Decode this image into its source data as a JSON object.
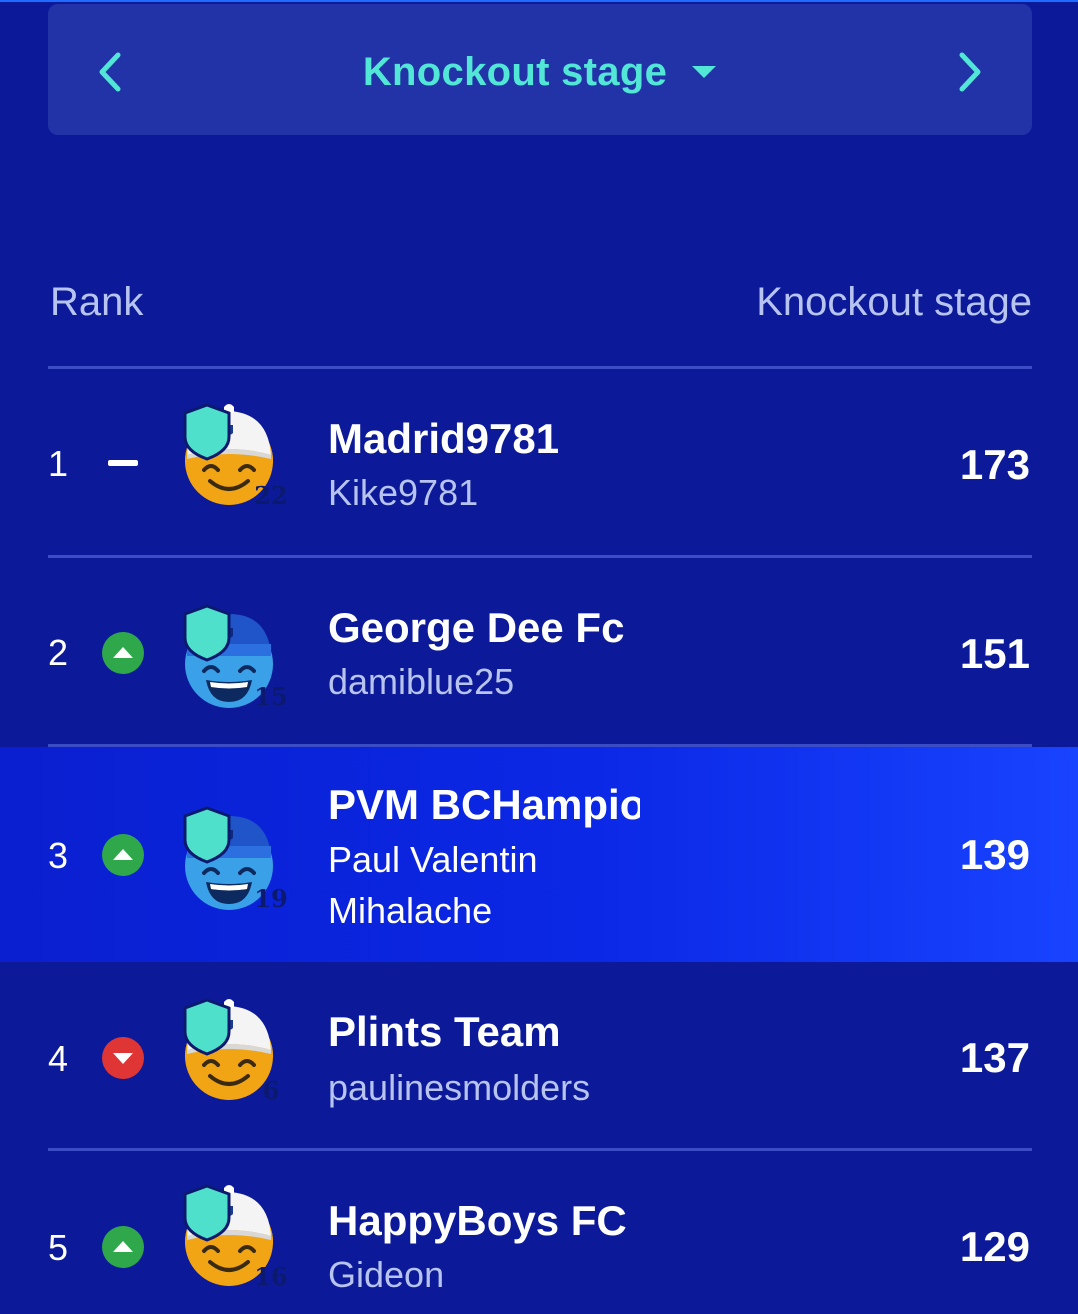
{
  "stage_selector": {
    "title": "Knockout stage",
    "prev_icon": "chevron-left-icon",
    "next_icon": "chevron-right-icon",
    "dropdown_icon": "caret-down-icon"
  },
  "columns": {
    "rank": "Rank",
    "score": "Knockout stage"
  },
  "colors": {
    "background": "#0c1a99",
    "accent": "#52e6d6",
    "trend_up": "#2ea84a",
    "trend_down": "#e03535",
    "highlight": "#1843ff"
  },
  "rows": [
    {
      "rank": "1",
      "trend": "same",
      "team": "Madrid9781",
      "manager": "Kike9781",
      "level": "22",
      "score": "173",
      "avatar": "yellow-smile-avatar"
    },
    {
      "rank": "2",
      "trend": "up",
      "team": "George Dee Fc",
      "manager": "damiblue25",
      "level": "15",
      "score": "151",
      "avatar": "blue-grin-avatar"
    },
    {
      "rank": "3",
      "trend": "up",
      "team": "PVM BCHampion",
      "manager": "Paul Valentin Mihalache",
      "level": "19",
      "score": "139",
      "avatar": "blue-grin-avatar",
      "highlighted": true
    },
    {
      "rank": "4",
      "trend": "down",
      "team": "Plints Team",
      "manager": "paulinesmolders",
      "level": "6",
      "score": "137",
      "avatar": "yellow-smile-avatar"
    },
    {
      "rank": "5",
      "trend": "up",
      "team": "HappyBoys FC",
      "manager": "Gideon",
      "level": "16",
      "score": "129",
      "avatar": "yellow-smile-avatar"
    }
  ]
}
